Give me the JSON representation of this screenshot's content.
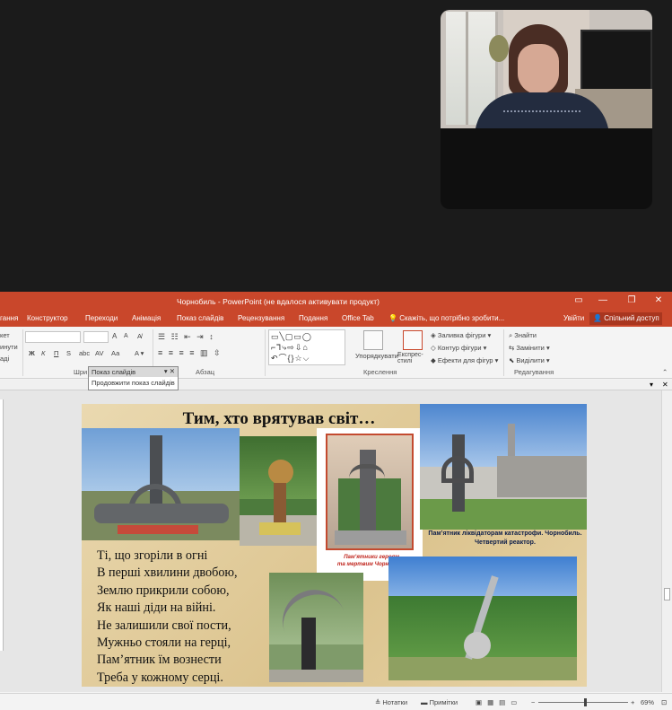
{
  "window": {
    "title": "Чорнобиль - PowerPoint (не вдалося активувати продукт)",
    "restore_icon": "restore-icon",
    "minimize_icon": "minimize-icon",
    "maximize_icon": "maximize-icon",
    "close_icon": "close-icon",
    "accent_color": "#c9472b"
  },
  "tabs": {
    "items": [
      "гання",
      "Конструктор",
      "Переходи",
      "Анімація",
      "Показ слайдів",
      "Рецензування",
      "Подання",
      "Office Tab"
    ],
    "tell_me": "Скажіть, що потрібно зробити...",
    "user": "Увійти",
    "share": "Спільний доступ"
  },
  "ribbon": {
    "clipboard_cut": "кет",
    "clipboard_copy": "инути",
    "clipboard_paste": "аді",
    "font_bold": "Ж",
    "font_italic": "К",
    "font_underline": "П",
    "font_strike": "S",
    "font_abc": "abc",
    "font_aa": "Аа",
    "font_grow": "A",
    "font_shrink": "A",
    "group_font": "Шри",
    "group_paragraph": "Абзац",
    "group_drawing": "Креслення",
    "group_editing": "Редагування",
    "arrange": "Упорядкувати",
    "quick_styles": "Експрес-стилі",
    "shape_fill": "Заливка фігури",
    "shape_outline": "Контур фігури",
    "shape_effects": "Ефекти для фігур",
    "find": "Знайти",
    "replace": "Замінити",
    "select": "Виділити"
  },
  "tooltip": {
    "header": "Показ слайдів",
    "item": "Продовжити показ слайдів"
  },
  "slide": {
    "title": "Тим, хто врятував  світ…",
    "poem": [
      "Ті, що згоріли в огні",
      "В перші хвилини двобою,",
      "Землю прикрили собою,",
      "Як наші діди на війні.",
      "Не залишили свої пости,",
      "Мужньо стояли на герці,",
      "Пам’ятник їм вознести",
      "Треба у кожному серці."
    ],
    "caption_center": "Пам’ятники героям\nта мертвим Чорнобиля",
    "caption_right": "Пам’ятник ліквідаторам катастрофи. Чорнобиль.\nЧетвертий реактор."
  },
  "status": {
    "notes": "Нотатки",
    "comments": "Примітки",
    "zoom": "69%"
  }
}
